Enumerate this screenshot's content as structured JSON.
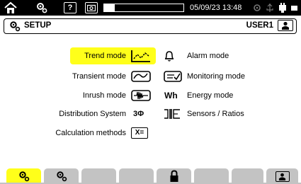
{
  "status_bar": {
    "datetime": "05/09/23 13:48",
    "progress": 0.13
  },
  "header": {
    "title": "SETUP",
    "user": "USER1"
  },
  "menu": {
    "left": [
      {
        "label": "Trend mode",
        "selected": true
      },
      {
        "label": "Transient mode"
      },
      {
        "label": "Inrush mode"
      },
      {
        "label": "Distribution System",
        "glyph": "3Φ"
      },
      {
        "label": "Calculation methods",
        "glyph": "X="
      }
    ],
    "right": [
      {
        "label": "Alarm mode"
      },
      {
        "label": "Monitoring mode"
      },
      {
        "label": "Energy mode",
        "glyph": "Wh"
      },
      {
        "label": "Sensors / Ratios"
      }
    ]
  },
  "colors": {
    "selection": "#ffff1a",
    "tab_inactive": "#c3c3c3",
    "status_bar": "#000000"
  },
  "icons": [
    "home-icon",
    "settings-icon",
    "help-icon",
    "screenshot-icon",
    "battery-icon",
    "network-icon",
    "usb-icon",
    "power-plug-icon",
    "setup-icon",
    "user-icon",
    "trend-icon",
    "alarm-bell-icon",
    "transient-icon",
    "monitoring-icon",
    "inrush-icon",
    "energy-icon",
    "distribution-icon",
    "sensors-icon",
    "calculation-icon",
    "lock-icon"
  ]
}
